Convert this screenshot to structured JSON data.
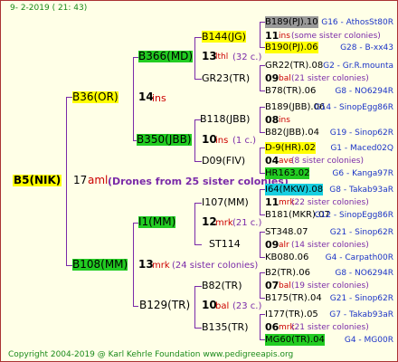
{
  "header": "9-   2-2019 (  21:  43)",
  "footer": "Copyright 2004-2019 @ Karl Kehrle Foundation    www.pedigreeapis.org",
  "root": {
    "name": "B5(NIK)",
    "num": "17",
    "code": "aml",
    "note": "(Drones from 25 sister colonies)"
  },
  "g1": [
    {
      "name": "B36(OR)",
      "num": "14",
      "code": "ins"
    },
    {
      "name": "B108(MM)",
      "num": "13",
      "code": "mrk",
      "note": "(24 sister colonies)"
    }
  ],
  "g2": [
    {
      "name": "B366(MD)"
    },
    {
      "name": "B350(JBB)",
      "num": "10",
      "code": "ins",
      "note": "(1 c.)"
    },
    {
      "name": "I1(MM)",
      "num": "12",
      "code": "mrk",
      "note": "(21 c.)"
    },
    {
      "name": "B129(TR)",
      "num": "10",
      "code": "bal",
      "note": "(23 c.)"
    }
  ],
  "g3": [
    {
      "name": "B144(JG)",
      "num": "13",
      "code": "lthl",
      "note": "(32 c.)"
    },
    {
      "name": "GR23(TR)"
    },
    {
      "name": "B118(JBB)"
    },
    {
      "name": "D09(FIV)"
    },
    {
      "name": "I107(MM)"
    },
    {
      "name": "ST114"
    },
    {
      "name": "B82(TR)"
    },
    {
      "name": "B135(TR)"
    }
  ],
  "g4": [
    {
      "name": "B189(PJ).10",
      "right": "G16 - AthosSt80R"
    },
    {
      "sub": "11",
      "code": "ins",
      "note": "(some sister colonies)"
    },
    {
      "name": "B190(PJ).06",
      "right": "G28 - B-xx43"
    },
    {
      "name": "GR22(TR).08",
      "right": "G2 - Gr.R.mounta"
    },
    {
      "sub": "09",
      "code": "bal",
      "note": "(21 sister colonies)"
    },
    {
      "name": "B78(TR).06",
      "right": "G8 - NO6294R"
    },
    {
      "name": "B189(JBB).06",
      "right": "G14 - SinopEgg86R"
    },
    {
      "sub": "08",
      "code": "ins"
    },
    {
      "name": "B82(JBB).04",
      "right": "G19 - Sinop62R"
    },
    {
      "name": "D-9(HR).02",
      "right": "G1 - Maced02Q"
    },
    {
      "sub": "04",
      "code": "ave",
      "note": "(8 sister colonies)"
    },
    {
      "name": "HR163.02",
      "right": "G6 - Kanga97R"
    },
    {
      "name": "I64(MKW).08",
      "right": "G8 - Takab93aR"
    },
    {
      "sub": "11",
      "code": "mrk",
      "note": "(22 sister colonies)"
    },
    {
      "name": "B181(MKR).07",
      "right": "G12 - SinopEgg86R"
    },
    {
      "name": "ST348.07",
      "right": "G21 - Sinop62R"
    },
    {
      "sub": "09",
      "code": "alr",
      "note": "(14 sister colonies)"
    },
    {
      "name": "KB080.06",
      "right": "G4 - Carpath00R"
    },
    {
      "name": "B2(TR).06",
      "right": "G8 - NO6294R"
    },
    {
      "sub": "07",
      "code": "bal",
      "note": "(19 sister colonies)"
    },
    {
      "name": "B175(TR).04",
      "right": "G21 - Sinop62R"
    },
    {
      "name": "I177(TR).05",
      "right": "G7 - Takab93aR"
    },
    {
      "sub": "06",
      "code": "mrk",
      "note": "(21 sister colonies)"
    },
    {
      "name": "MG60(TR).04",
      "right": "G4 - MG00R"
    }
  ]
}
